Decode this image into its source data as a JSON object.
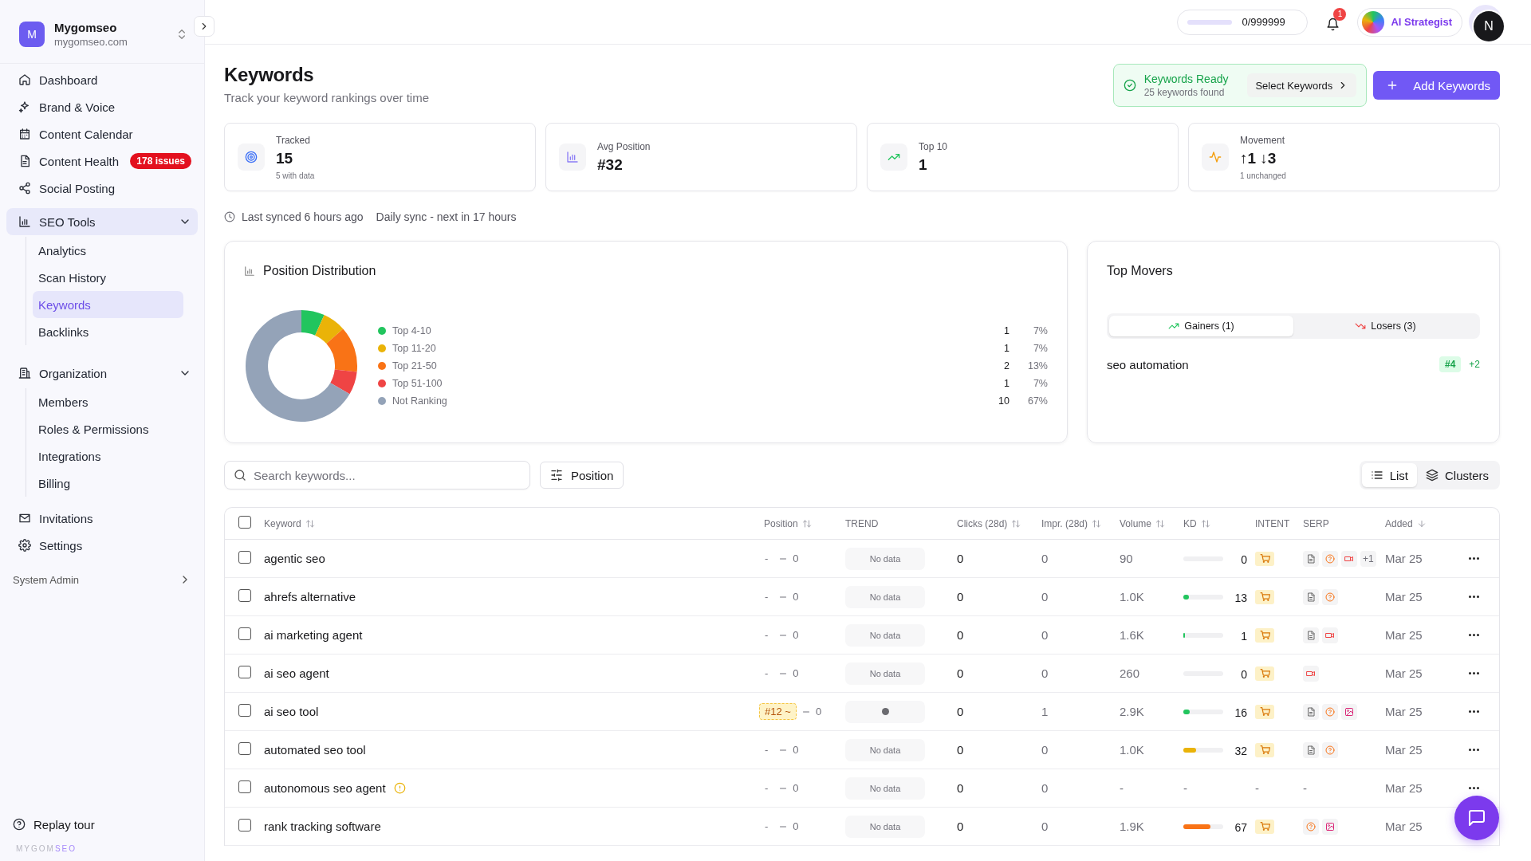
{
  "sidebar": {
    "workspace": {
      "initial": "M",
      "name": "Mygomseo",
      "domain": "mygomseo.com"
    },
    "nav": [
      {
        "label": "Dashboard",
        "selected": false
      },
      {
        "label": "Brand & Voice",
        "selected": false
      },
      {
        "label": "Content Calendar",
        "selected": false
      },
      {
        "label": "Content Health",
        "selected": false,
        "badge": "178 issues"
      },
      {
        "label": "Social Posting",
        "selected": false
      },
      {
        "label": "SEO Tools",
        "selected": true,
        "expanded": true,
        "children": [
          {
            "label": "Analytics",
            "selected": false
          },
          {
            "label": "Scan History",
            "selected": false
          },
          {
            "label": "Keywords",
            "selected": true
          },
          {
            "label": "Backlinks",
            "selected": false
          }
        ]
      },
      {
        "label": "Organization",
        "selected": false,
        "expanded": true,
        "children": [
          {
            "label": "Members",
            "selected": false
          },
          {
            "label": "Roles & Permissions",
            "selected": false
          },
          {
            "label": "Integrations",
            "selected": false
          },
          {
            "label": "Billing",
            "selected": false
          }
        ]
      },
      {
        "label": "Invitations",
        "selected": false
      },
      {
        "label": "Settings",
        "selected": false
      }
    ],
    "section": "System Admin",
    "replay": "Replay tour",
    "wordmark": [
      "MYGOM",
      "SEO"
    ]
  },
  "topbar": {
    "credits": "0/999999",
    "notifications": "1",
    "assistant": "AI Strategist",
    "user_initial": "N"
  },
  "header": {
    "title": "Keywords",
    "subtitle": "Track your keyword rankings over time",
    "ready": {
      "title": "Keywords Ready",
      "subtitle": "25 keywords found",
      "action": "Select Keywords"
    },
    "add_button": "Add Keywords"
  },
  "stats": [
    {
      "label": "Tracked",
      "value": "15",
      "note": "5 with data"
    },
    {
      "label": "Avg Position",
      "value": "#32"
    },
    {
      "label": "Top 10",
      "value": "1"
    },
    {
      "label": "Movement",
      "value": "↑1 ↓3",
      "note": "1 unchanged"
    }
  ],
  "sync": {
    "last": "Last synced 6 hours ago",
    "next": "Daily sync - next in 17 hours"
  },
  "distribution": {
    "title": "Position Distribution",
    "chart_data": {
      "type": "donut",
      "categories": [
        "Top 4-10",
        "Top 11-20",
        "Top 21-50",
        "Top 51-100",
        "Not Ranking"
      ],
      "values": [
        6.7,
        6.7,
        13.3,
        6.7,
        66.6
      ]
    },
    "legend": [
      {
        "count": "1",
        "percent": "7%",
        "color": "#22c55e"
      },
      {
        "count": "1",
        "percent": "7%",
        "color": "#eab308"
      },
      {
        "count": "2",
        "percent": "13%",
        "color": "#f97316"
      },
      {
        "count": "1",
        "percent": "7%",
        "color": "#ef4444"
      },
      {
        "count": "10",
        "percent": "67%",
        "color": "#94a3b8"
      }
    ]
  },
  "movers": {
    "title": "Top Movers",
    "tabs": [
      {
        "label": "Gainers (1)",
        "selected": true
      },
      {
        "label": "Losers (3)",
        "selected": false
      }
    ],
    "items": [
      {
        "keyword": "seo automation",
        "position": "#4",
        "change": "+2"
      }
    ]
  },
  "toolbar": {
    "search": {
      "placeholder": "Search keywords..."
    },
    "filter": "Position",
    "views": [
      {
        "label": "List",
        "selected": true
      },
      {
        "label": "Clusters",
        "selected": false
      }
    ]
  },
  "table": {
    "select_all": {
      "checked": false
    },
    "columns": [
      {
        "label": "Keyword",
        "kind": "sortable"
      },
      {
        "label": "Position",
        "kind": "sortable"
      },
      {
        "label": "TREND",
        "kind": "plain"
      },
      {
        "label": "Clicks (28d)",
        "kind": "sortable"
      },
      {
        "label": "Impr. (28d)",
        "kind": "sortable"
      },
      {
        "label": "Volume",
        "kind": "sortable"
      },
      {
        "label": "KD",
        "kind": "sortable"
      },
      {
        "label": "INTENT",
        "kind": "plain"
      },
      {
        "label": "SERP",
        "kind": "plain"
      },
      {
        "label": "Added",
        "kind": "sorted_desc"
      }
    ],
    "rows": [
      {
        "checked": false,
        "keyword": "agentic seo",
        "warning": false,
        "position": {
          "kind": "none",
          "text": "-"
        },
        "change": "0",
        "trend": {
          "kind": "empty",
          "text": "No data"
        },
        "clicks": "0",
        "impressions": "0",
        "volume": "90",
        "kd": {
          "kind": "bar",
          "value": "0"
        },
        "intent": {
          "kind": "commercial"
        },
        "serp": {
          "kind": "icons",
          "items": [
            {
              "kind": "article"
            },
            {
              "kind": "question"
            },
            {
              "kind": "video"
            }
          ],
          "more": "+1"
        },
        "added": "Mar 25"
      },
      {
        "checked": false,
        "keyword": "ahrefs alternative",
        "warning": false,
        "position": {
          "kind": "none",
          "text": "-"
        },
        "change": "0",
        "trend": {
          "kind": "empty",
          "text": "No data"
        },
        "clicks": "0",
        "impressions": "0",
        "volume": "1.0K",
        "kd": {
          "kind": "bar",
          "level": 0.13,
          "value": "13"
        },
        "intent": {
          "kind": "commercial"
        },
        "serp": {
          "kind": "icons",
          "items": [
            {
              "kind": "article"
            },
            {
              "kind": "question"
            }
          ]
        },
        "added": "Mar 25"
      },
      {
        "checked": false,
        "keyword": "ai marketing agent",
        "warning": false,
        "position": {
          "kind": "none",
          "text": "-"
        },
        "change": "0",
        "trend": {
          "kind": "empty",
          "text": "No data"
        },
        "clicks": "0",
        "impressions": "0",
        "volume": "1.6K",
        "kd": {
          "kind": "bar",
          "level": 0.01,
          "value": "1"
        },
        "intent": {
          "kind": "commercial"
        },
        "serp": {
          "kind": "icons",
          "items": [
            {
              "kind": "article"
            },
            {
              "kind": "video"
            }
          ]
        },
        "added": "Mar 25"
      },
      {
        "checked": false,
        "keyword": "ai seo agent",
        "warning": false,
        "position": {
          "kind": "none",
          "text": "-"
        },
        "change": "0",
        "trend": {
          "kind": "empty",
          "text": "No data"
        },
        "clicks": "0",
        "impressions": "0",
        "volume": "260",
        "kd": {
          "kind": "bar",
          "value": "0"
        },
        "intent": {
          "kind": "commercial"
        },
        "serp": {
          "kind": "icons",
          "items": [
            {
              "kind": "video"
            }
          ]
        },
        "added": "Mar 25"
      },
      {
        "checked": false,
        "keyword": "ai seo tool",
        "warning": false,
        "position": {
          "kind": "estimate",
          "text": "#12 ~"
        },
        "change": "0",
        "trend": {
          "kind": "point"
        },
        "clicks": "0",
        "impressions": "1",
        "volume": "2.9K",
        "kd": {
          "kind": "bar",
          "level": 0.16,
          "value": "16"
        },
        "intent": {
          "kind": "commercial"
        },
        "serp": {
          "kind": "icons",
          "items": [
            {
              "kind": "article"
            },
            {
              "kind": "question"
            },
            {
              "kind": "image"
            }
          ]
        },
        "added": "Mar 25"
      },
      {
        "checked": false,
        "keyword": "automated seo tool",
        "warning": false,
        "position": {
          "kind": "none",
          "text": "-"
        },
        "change": "0",
        "trend": {
          "kind": "empty",
          "text": "No data"
        },
        "clicks": "0",
        "impressions": "0",
        "volume": "1.0K",
        "kd": {
          "kind": "bar",
          "level": 0.32,
          "value": "32"
        },
        "intent": {
          "kind": "commercial"
        },
        "serp": {
          "kind": "icons",
          "items": [
            {
              "kind": "article"
            },
            {
              "kind": "question"
            }
          ]
        },
        "added": "Mar 25"
      },
      {
        "checked": false,
        "keyword": "autonomous seo agent",
        "warning": true,
        "position": {
          "kind": "none",
          "text": "-"
        },
        "change": "0",
        "trend": {
          "kind": "empty",
          "text": "No data"
        },
        "clicks": "0",
        "impressions": "0",
        "volume": "-",
        "kd": {
          "kind": "none",
          "text": "-"
        },
        "intent": {
          "kind": "none",
          "text": "-"
        },
        "serp": {
          "kind": "none",
          "text": "-"
        },
        "added": "Mar 25"
      },
      {
        "checked": false,
        "keyword": "rank tracking software",
        "warning": false,
        "position": {
          "kind": "none",
          "text": "-"
        },
        "change": "0",
        "trend": {
          "kind": "empty",
          "text": "No data"
        },
        "clicks": "0",
        "impressions": "0",
        "volume": "1.9K",
        "kd": {
          "kind": "bar",
          "level": 0.67,
          "value": "67"
        },
        "intent": {
          "kind": "commercial"
        },
        "serp": {
          "kind": "icons",
          "items": [
            {
              "kind": "question"
            },
            {
              "kind": "image"
            }
          ]
        },
        "added": "Mar 25"
      }
    ]
  }
}
